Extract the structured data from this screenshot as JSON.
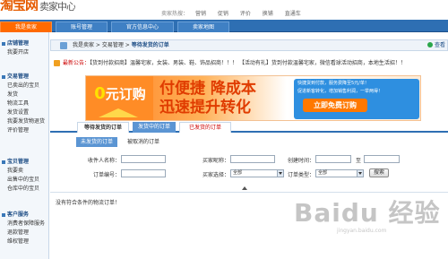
{
  "header": {
    "logo_text": "淘宝网",
    "logo_sub": "卖家中心",
    "hot_label": "卖家热搜：",
    "hot_links": [
      "营销",
      "促销",
      "评价",
      "换铺",
      "直通车"
    ]
  },
  "nav": {
    "tabs": [
      "我是卖家",
      "账号管理",
      "官方信息中心",
      "卖家地图"
    ]
  },
  "sidebar": {
    "sections": [
      {
        "title": "店铺管理",
        "items": [
          "我要开店"
        ]
      },
      {
        "title": "交易管理",
        "items": [
          "已卖出的宝贝",
          "发货",
          "物流工具",
          "发货设置",
          "我要发货物退货",
          "评价管理"
        ]
      },
      {
        "title": "宝贝管理",
        "items": [
          "我要卖",
          "出售中的宝贝",
          "仓库中的宝贝"
        ]
      },
      {
        "title": "客户服务",
        "items": [
          "消费者保障服务",
          "退款管理",
          "维权管理"
        ]
      }
    ]
  },
  "breadcrumb": {
    "items": [
      "我是卖家",
      "交易管理"
    ],
    "current": "等待发货的订单",
    "help": "查看"
  },
  "notice": {
    "label": "最新公告：",
    "text": "【货到付款招商】温馨宅家，女装、男装、鞋、饰品招商！！！ 【活动有礼】货到付款温馨宅家，微信看球活动招商，本地生活招！！"
  },
  "banner": {
    "left_text": "元订购",
    "left_zero": "0",
    "line1": "付便捷 降成本",
    "line2": "迅速提升转化",
    "right_text1": "快捷货到付款，服务费降至5元/单！",
    "right_text2": "促进新客转化，增加销售利润，一举两得！",
    "button": "立即免费订购"
  },
  "tabs": {
    "items": [
      "等待发货的订单",
      "发货中的订单",
      "已发货的订单"
    ]
  },
  "subtabs": {
    "items": [
      "未发货的订单",
      "被取消的订单"
    ]
  },
  "form": {
    "buyer_name_label": "收件人名称：",
    "buyer_nick_label": "买家昵称：",
    "created_label": "创建时间：",
    "to_label": "至",
    "order_no_label": "订单编号：",
    "buyer_choice_label": "买家选择：",
    "buyer_choice_value": "全部",
    "order_type_label": "订单类型：",
    "order_type_value": "全部",
    "search_button": "搜索"
  },
  "empty_text": "没有符合条件的物流订单！",
  "watermark": {
    "brand": "Baidu 经验",
    "url": "jingyan.baidu.com"
  }
}
